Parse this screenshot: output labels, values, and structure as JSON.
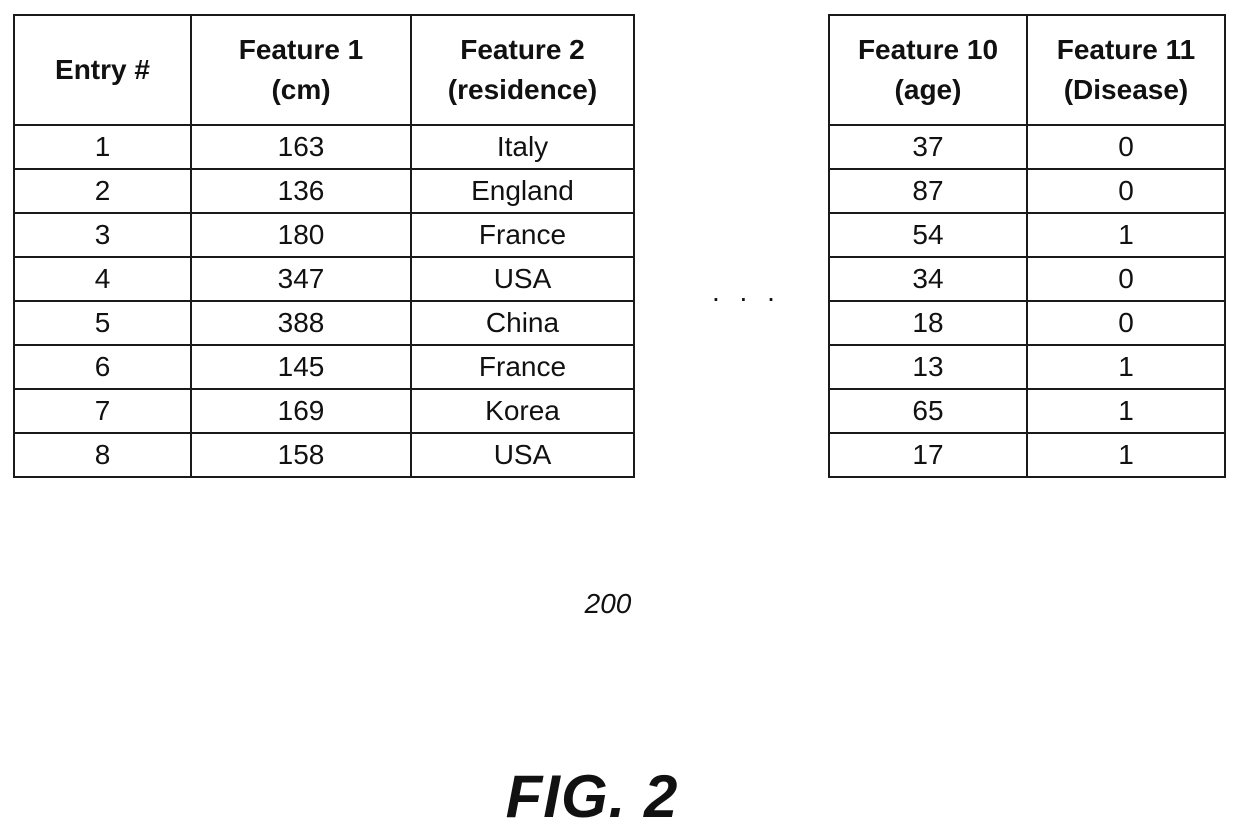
{
  "figure": {
    "reference_numeral": "200",
    "caption": "FIG. 2",
    "ellipsis": ". . ."
  },
  "left_table": {
    "headers": [
      [
        "Entry #"
      ],
      [
        "Feature 1",
        "(cm)"
      ],
      [
        "Feature 2",
        "(residence)"
      ]
    ],
    "rows": [
      [
        "1",
        "163",
        "Italy"
      ],
      [
        "2",
        "136",
        "England"
      ],
      [
        "3",
        "180",
        "France"
      ],
      [
        "4",
        "347",
        "USA"
      ],
      [
        "5",
        "388",
        "China"
      ],
      [
        "6",
        "145",
        "France"
      ],
      [
        "7",
        "169",
        "Korea"
      ],
      [
        "8",
        "158",
        "USA"
      ]
    ]
  },
  "right_table": {
    "headers": [
      [
        "Feature 10",
        "(age)"
      ],
      [
        "Feature 11",
        "(Disease)"
      ]
    ],
    "rows": [
      [
        "37",
        "0"
      ],
      [
        "87",
        "0"
      ],
      [
        "54",
        "1"
      ],
      [
        "34",
        "0"
      ],
      [
        "18",
        "0"
      ],
      [
        "13",
        "1"
      ],
      [
        "65",
        "1"
      ],
      [
        "17",
        "1"
      ]
    ]
  }
}
